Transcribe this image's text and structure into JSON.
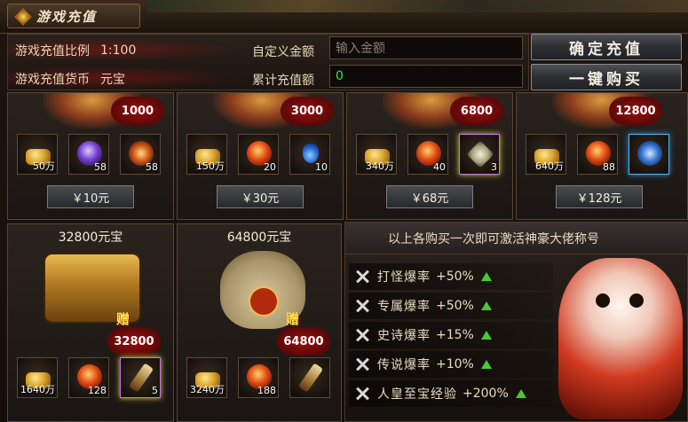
{
  "title": "游戏充值",
  "header": {
    "ratio_label": "游戏充值比例",
    "ratio_value": "1:100",
    "currency_label": "游戏充值货币",
    "currency_value": "元宝",
    "custom_label": "自定义金额",
    "custom_placeholder": "输入金额",
    "total_label": "累计充值额",
    "total_value": "0",
    "confirm_button": "确定充值",
    "onekey_button": "一键购买"
  },
  "packages_top": [
    {
      "badge": "1000",
      "items": [
        {
          "icon": "gold-ingot-icon",
          "qty": "50万"
        },
        {
          "icon": "purple-orb-icon",
          "qty": "58"
        },
        {
          "icon": "fire-orb-icon",
          "qty": "58"
        }
      ],
      "price": "￥10元"
    },
    {
      "badge": "3000",
      "items": [
        {
          "icon": "gold-ingot-icon",
          "qty": "150万"
        },
        {
          "icon": "fire-orb-icon",
          "qty": "20"
        },
        {
          "icon": "potion-icon",
          "qty": "10"
        }
      ],
      "price": "￥30元"
    },
    {
      "badge": "6800",
      "items": [
        {
          "icon": "gold-ingot-icon",
          "qty": "340万"
        },
        {
          "icon": "fire-orb-icon",
          "qty": "40"
        },
        {
          "icon": "star-gem-icon",
          "qty": "3"
        }
      ],
      "price": "￥68元"
    },
    {
      "badge": "12800",
      "items": [
        {
          "icon": "gold-ingot-icon",
          "qty": "640万"
        },
        {
          "icon": "fire-orb-icon",
          "qty": "88"
        },
        {
          "icon": "blue-wing-icon",
          "qty": ""
        }
      ],
      "price": "￥128元"
    }
  ],
  "packages_bottom": [
    {
      "title": "32800元宝",
      "gift": "赠",
      "badge": "32800",
      "items": [
        {
          "icon": "gold-ingot-icon",
          "qty": "1640万"
        },
        {
          "icon": "fire-orb-icon",
          "qty": "128"
        },
        {
          "icon": "scroll-icon",
          "qty": "5"
        }
      ]
    },
    {
      "title": "64800元宝",
      "gift": "赠",
      "badge": "64800",
      "items": [
        {
          "icon": "gold-ingot-icon",
          "qty": "3240万"
        },
        {
          "icon": "fire-orb-icon",
          "qty": "188"
        },
        {
          "icon": "scroll-icon",
          "qty": ""
        }
      ]
    }
  ],
  "bonus": {
    "heading": "以上各购买一次即可激活神豪大佬称号",
    "rows": [
      {
        "label": "打怪爆率",
        "value": "+50%"
      },
      {
        "label": "专属爆率",
        "value": "+50%"
      },
      {
        "label": "史诗爆率",
        "value": "+15%"
      },
      {
        "label": "传说爆率",
        "value": "+10%"
      },
      {
        "label": "人皇至宝经验",
        "value": "+200%"
      }
    ]
  },
  "colors": {
    "accent_green": "#36e04a",
    "badge_red": "#9a1010",
    "gold": "#e8b850"
  }
}
